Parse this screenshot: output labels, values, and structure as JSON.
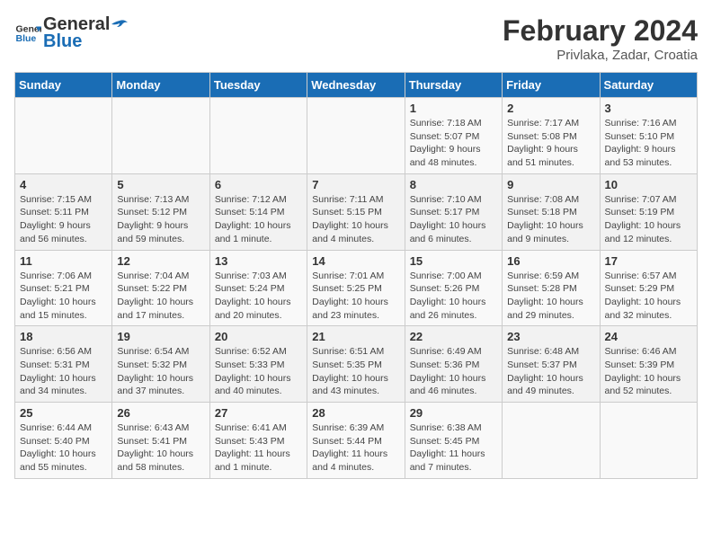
{
  "logo": {
    "line1": "General",
    "line2": "Blue"
  },
  "title": "February 2024",
  "subtitle": "Privlaka, Zadar, Croatia",
  "days_of_week": [
    "Sunday",
    "Monday",
    "Tuesday",
    "Wednesday",
    "Thursday",
    "Friday",
    "Saturday"
  ],
  "weeks": [
    [
      {
        "day": "",
        "info": ""
      },
      {
        "day": "",
        "info": ""
      },
      {
        "day": "",
        "info": ""
      },
      {
        "day": "",
        "info": ""
      },
      {
        "day": "1",
        "info": "Sunrise: 7:18 AM\nSunset: 5:07 PM\nDaylight: 9 hours\nand 48 minutes."
      },
      {
        "day": "2",
        "info": "Sunrise: 7:17 AM\nSunset: 5:08 PM\nDaylight: 9 hours\nand 51 minutes."
      },
      {
        "day": "3",
        "info": "Sunrise: 7:16 AM\nSunset: 5:10 PM\nDaylight: 9 hours\nand 53 minutes."
      }
    ],
    [
      {
        "day": "4",
        "info": "Sunrise: 7:15 AM\nSunset: 5:11 PM\nDaylight: 9 hours\nand 56 minutes."
      },
      {
        "day": "5",
        "info": "Sunrise: 7:13 AM\nSunset: 5:12 PM\nDaylight: 9 hours\nand 59 minutes."
      },
      {
        "day": "6",
        "info": "Sunrise: 7:12 AM\nSunset: 5:14 PM\nDaylight: 10 hours\nand 1 minute."
      },
      {
        "day": "7",
        "info": "Sunrise: 7:11 AM\nSunset: 5:15 PM\nDaylight: 10 hours\nand 4 minutes."
      },
      {
        "day": "8",
        "info": "Sunrise: 7:10 AM\nSunset: 5:17 PM\nDaylight: 10 hours\nand 6 minutes."
      },
      {
        "day": "9",
        "info": "Sunrise: 7:08 AM\nSunset: 5:18 PM\nDaylight: 10 hours\nand 9 minutes."
      },
      {
        "day": "10",
        "info": "Sunrise: 7:07 AM\nSunset: 5:19 PM\nDaylight: 10 hours\nand 12 minutes."
      }
    ],
    [
      {
        "day": "11",
        "info": "Sunrise: 7:06 AM\nSunset: 5:21 PM\nDaylight: 10 hours\nand 15 minutes."
      },
      {
        "day": "12",
        "info": "Sunrise: 7:04 AM\nSunset: 5:22 PM\nDaylight: 10 hours\nand 17 minutes."
      },
      {
        "day": "13",
        "info": "Sunrise: 7:03 AM\nSunset: 5:24 PM\nDaylight: 10 hours\nand 20 minutes."
      },
      {
        "day": "14",
        "info": "Sunrise: 7:01 AM\nSunset: 5:25 PM\nDaylight: 10 hours\nand 23 minutes."
      },
      {
        "day": "15",
        "info": "Sunrise: 7:00 AM\nSunset: 5:26 PM\nDaylight: 10 hours\nand 26 minutes."
      },
      {
        "day": "16",
        "info": "Sunrise: 6:59 AM\nSunset: 5:28 PM\nDaylight: 10 hours\nand 29 minutes."
      },
      {
        "day": "17",
        "info": "Sunrise: 6:57 AM\nSunset: 5:29 PM\nDaylight: 10 hours\nand 32 minutes."
      }
    ],
    [
      {
        "day": "18",
        "info": "Sunrise: 6:56 AM\nSunset: 5:31 PM\nDaylight: 10 hours\nand 34 minutes."
      },
      {
        "day": "19",
        "info": "Sunrise: 6:54 AM\nSunset: 5:32 PM\nDaylight: 10 hours\nand 37 minutes."
      },
      {
        "day": "20",
        "info": "Sunrise: 6:52 AM\nSunset: 5:33 PM\nDaylight: 10 hours\nand 40 minutes."
      },
      {
        "day": "21",
        "info": "Sunrise: 6:51 AM\nSunset: 5:35 PM\nDaylight: 10 hours\nand 43 minutes."
      },
      {
        "day": "22",
        "info": "Sunrise: 6:49 AM\nSunset: 5:36 PM\nDaylight: 10 hours\nand 46 minutes."
      },
      {
        "day": "23",
        "info": "Sunrise: 6:48 AM\nSunset: 5:37 PM\nDaylight: 10 hours\nand 49 minutes."
      },
      {
        "day": "24",
        "info": "Sunrise: 6:46 AM\nSunset: 5:39 PM\nDaylight: 10 hours\nand 52 minutes."
      }
    ],
    [
      {
        "day": "25",
        "info": "Sunrise: 6:44 AM\nSunset: 5:40 PM\nDaylight: 10 hours\nand 55 minutes."
      },
      {
        "day": "26",
        "info": "Sunrise: 6:43 AM\nSunset: 5:41 PM\nDaylight: 10 hours\nand 58 minutes."
      },
      {
        "day": "27",
        "info": "Sunrise: 6:41 AM\nSunset: 5:43 PM\nDaylight: 11 hours\nand 1 minute."
      },
      {
        "day": "28",
        "info": "Sunrise: 6:39 AM\nSunset: 5:44 PM\nDaylight: 11 hours\nand 4 minutes."
      },
      {
        "day": "29",
        "info": "Sunrise: 6:38 AM\nSunset: 5:45 PM\nDaylight: 11 hours\nand 7 minutes."
      },
      {
        "day": "",
        "info": ""
      },
      {
        "day": "",
        "info": ""
      }
    ]
  ]
}
